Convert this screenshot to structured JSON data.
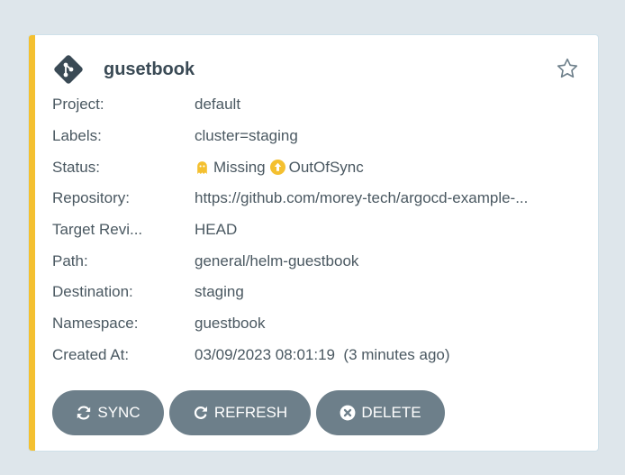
{
  "app": {
    "name": "gusetbook",
    "fields": [
      {
        "label": "Project:",
        "value": "default"
      },
      {
        "label": "Labels:",
        "value": "cluster=staging"
      },
      {
        "label": "Status:",
        "health": "Missing",
        "sync": "OutOfSync"
      },
      {
        "label": "Repository:",
        "value": "https://github.com/morey-tech/argocd-example-..."
      },
      {
        "label": "Target Revi...",
        "value": "HEAD"
      },
      {
        "label": "Path:",
        "value": "general/helm-guestbook"
      },
      {
        "label": "Destination:",
        "value": "staging"
      },
      {
        "label": "Namespace:",
        "value": "guestbook"
      },
      {
        "label": "Created At:",
        "value": "03/09/2023 08:01:19  (3 minutes ago)"
      }
    ]
  },
  "actions": {
    "sync_label": "SYNC",
    "refresh_label": "REFRESH",
    "delete_label": "DELETE"
  },
  "colors": {
    "stripe": "#f4c030",
    "missing": "#f4c030",
    "out_of_sync": "#f4c030",
    "button": "#6d7f8a",
    "text": "#4a5861"
  },
  "icons": {
    "app": "git-diamond-icon",
    "favorite": "star-icon",
    "health": "ghost-icon",
    "sync_status": "arrow-up-circle-icon",
    "sync": "sync-icon",
    "refresh": "redo-icon",
    "delete": "times-circle-icon"
  }
}
